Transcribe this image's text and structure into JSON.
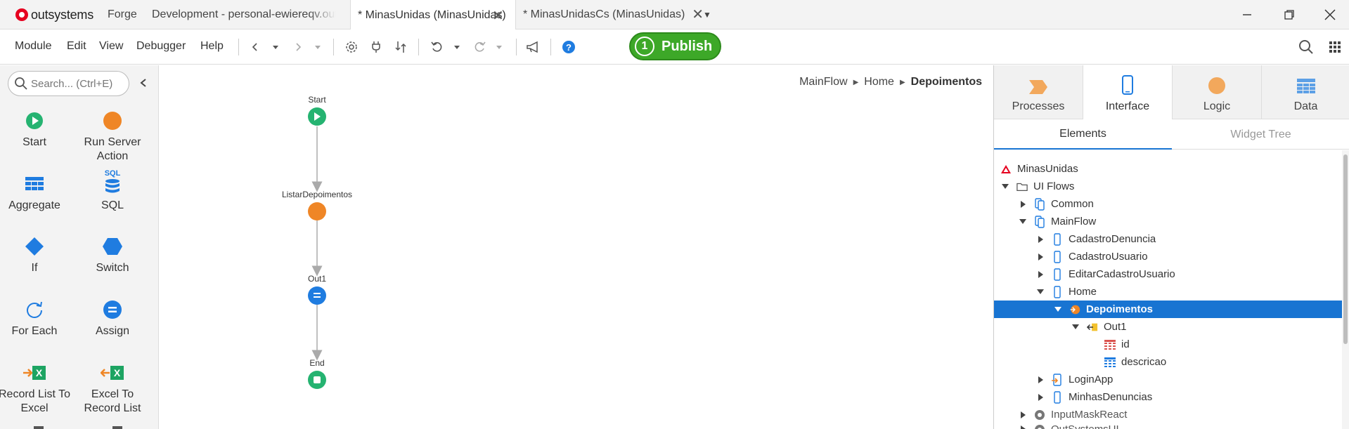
{
  "titlebar": {
    "logo_text": "outsystems",
    "tabs": [
      {
        "label": "Forge"
      },
      {
        "label": "Development - personal-ewiereqv.outsystemscloud.com"
      },
      {
        "label": "* MinasUnidas (MinasUnidas)"
      },
      {
        "label": "* MinasUnidasCs (MinasUnidas)"
      }
    ],
    "close_glyph": "✕",
    "overflow_glyph": "▼"
  },
  "menu": {
    "items": [
      "Module",
      "Edit",
      "View",
      "Debugger",
      "Help"
    ]
  },
  "publish": {
    "count": "1",
    "label": "Publish",
    "color": "#3da828"
  },
  "toolbox": {
    "search_placeholder": "Search... (Ctrl+E)",
    "tools": [
      {
        "label": "Start",
        "icon": "start-icon"
      },
      {
        "label": "Run Server Action",
        "icon": "run-server-action-icon"
      },
      {
        "label": "Aggregate",
        "icon": "aggregate-icon"
      },
      {
        "label": "SQL",
        "icon": "sql-icon"
      },
      {
        "label": "If",
        "icon": "if-icon"
      },
      {
        "label": "Switch",
        "icon": "switch-icon"
      },
      {
        "label": "For Each",
        "icon": "for-each-icon"
      },
      {
        "label": "Assign",
        "icon": "assign-icon"
      },
      {
        "label": "Record List To Excel",
        "icon": "record-list-to-excel-icon"
      },
      {
        "label": "Excel To Record List",
        "icon": "excel-to-record-list-icon"
      }
    ],
    "sql_text": "SQL"
  },
  "canvas": {
    "breadcrumb": [
      "MainFlow",
      "Home",
      "Depoimentos"
    ],
    "flow_nodes": [
      {
        "label": "Start",
        "type": "start",
        "color": "#25b371"
      },
      {
        "label": "ListarDepoimentos",
        "type": "server-action",
        "color": "#ef8626"
      },
      {
        "label": "Out1",
        "type": "assign",
        "color": "#1f7ce0"
      },
      {
        "label": "End",
        "type": "end",
        "color": "#25b371"
      }
    ]
  },
  "right_panel": {
    "tabs": [
      {
        "label": "Processes",
        "icon": "processes-icon"
      },
      {
        "label": "Interface",
        "icon": "interface-icon"
      },
      {
        "label": "Logic",
        "icon": "logic-icon"
      },
      {
        "label": "Data",
        "icon": "data-icon"
      }
    ],
    "subtabs": [
      "Elements",
      "Widget Tree"
    ],
    "tree": [
      {
        "label": "MinasUnidas",
        "icon": "module-icon"
      },
      {
        "label": "UI Flows",
        "icon": "folder-icon"
      },
      {
        "label": "Common",
        "icon": "ui-flow-icon"
      },
      {
        "label": "MainFlow",
        "icon": "ui-flow-icon"
      },
      {
        "label": "CadastroDenuncia",
        "icon": "screen-icon"
      },
      {
        "label": "CadastroUsuario",
        "icon": "screen-icon"
      },
      {
        "label": "EditarCadastroUsuario",
        "icon": "screen-icon"
      },
      {
        "label": "Home",
        "icon": "screen-icon"
      },
      {
        "label": "Depoimentos",
        "icon": "data-action-icon"
      },
      {
        "label": "Out1",
        "icon": "output-parameter-icon"
      },
      {
        "label": "id",
        "icon": "attribute-icon"
      },
      {
        "label": "descricao",
        "icon": "attribute-icon"
      },
      {
        "label": "LoginApp",
        "icon": "screen-link-icon"
      },
      {
        "label": "MinhasDenuncias",
        "icon": "screen-icon"
      },
      {
        "label": "InputMaskReact",
        "icon": "dependency-icon"
      },
      {
        "label": "OutSystemsUI",
        "icon": "dependency-icon"
      }
    ],
    "selected_color": "#1874d2"
  }
}
